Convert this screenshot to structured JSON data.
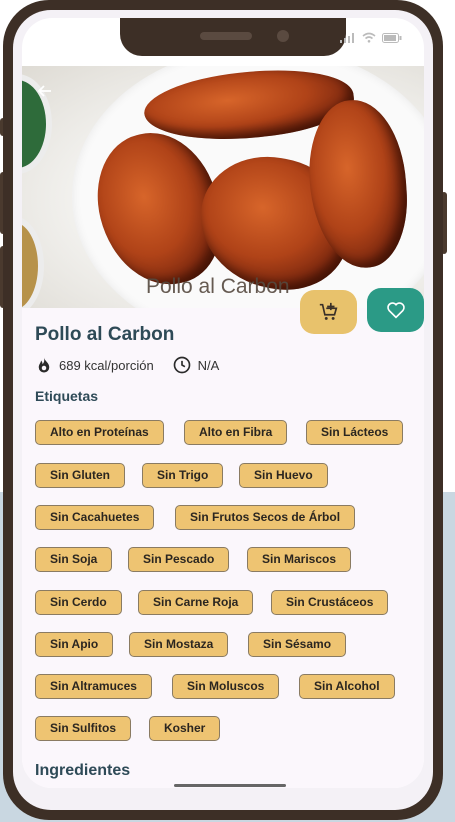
{
  "hero": {
    "image_caption": "Pollo al Carbon"
  },
  "recipe": {
    "title": "Pollo al Carbon",
    "calories": "689 kcal/porción",
    "time": "N/A"
  },
  "tags_section": {
    "heading": "Etiquetas",
    "tags": [
      "Alto en Proteínas",
      "Alto en Fibra",
      "Sin Lácteos",
      "Sin Gluten",
      "Sin Trigo",
      "Sin Huevo",
      "Sin Cacahuetes",
      "Sin Frutos Secos de Árbol",
      "Sin Soja",
      "Sin Pescado",
      "Sin Mariscos",
      "Sin Cerdo",
      "Sin Carne Roja",
      "Sin Crustáceos",
      "Sin Apio",
      "Sin Mostaza",
      "Sin Sésamo",
      "Sin Altramuces",
      "Sin Moluscos",
      "Sin Alcohol",
      "Sin Sulfitos",
      "Kosher"
    ]
  },
  "ingredients_section": {
    "heading": "Ingredientes"
  },
  "icons": {
    "back": "arrow-left-icon",
    "cart": "add-to-cart-icon",
    "favorite": "heart-icon",
    "calories": "flame-icon",
    "time": "clock-icon"
  },
  "colors": {
    "tag_fill": "#eec472",
    "cart_button": "#e8c26c",
    "favorite_button": "#2b9a86",
    "title_text": "#2e4a57"
  }
}
